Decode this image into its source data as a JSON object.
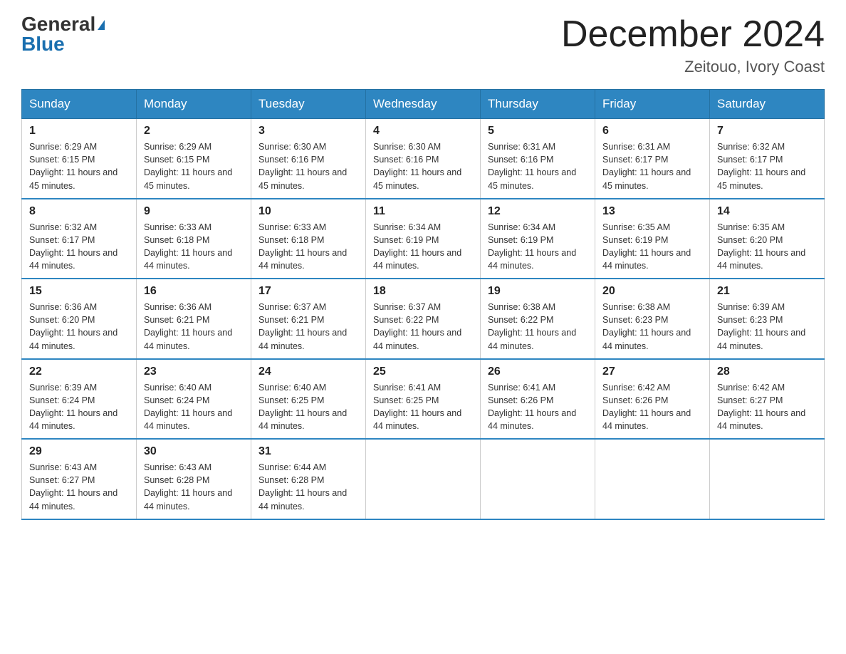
{
  "header": {
    "logo_general": "General",
    "logo_blue": "Blue",
    "title": "December 2024",
    "subtitle": "Zeitouo, Ivory Coast"
  },
  "days_of_week": [
    "Sunday",
    "Monday",
    "Tuesday",
    "Wednesday",
    "Thursday",
    "Friday",
    "Saturday"
  ],
  "weeks": [
    [
      {
        "day": "1",
        "sunrise": "6:29 AM",
        "sunset": "6:15 PM",
        "daylight": "11 hours and 45 minutes."
      },
      {
        "day": "2",
        "sunrise": "6:29 AM",
        "sunset": "6:15 PM",
        "daylight": "11 hours and 45 minutes."
      },
      {
        "day": "3",
        "sunrise": "6:30 AM",
        "sunset": "6:16 PM",
        "daylight": "11 hours and 45 minutes."
      },
      {
        "day": "4",
        "sunrise": "6:30 AM",
        "sunset": "6:16 PM",
        "daylight": "11 hours and 45 minutes."
      },
      {
        "day": "5",
        "sunrise": "6:31 AM",
        "sunset": "6:16 PM",
        "daylight": "11 hours and 45 minutes."
      },
      {
        "day": "6",
        "sunrise": "6:31 AM",
        "sunset": "6:17 PM",
        "daylight": "11 hours and 45 minutes."
      },
      {
        "day": "7",
        "sunrise": "6:32 AM",
        "sunset": "6:17 PM",
        "daylight": "11 hours and 45 minutes."
      }
    ],
    [
      {
        "day": "8",
        "sunrise": "6:32 AM",
        "sunset": "6:17 PM",
        "daylight": "11 hours and 44 minutes."
      },
      {
        "day": "9",
        "sunrise": "6:33 AM",
        "sunset": "6:18 PM",
        "daylight": "11 hours and 44 minutes."
      },
      {
        "day": "10",
        "sunrise": "6:33 AM",
        "sunset": "6:18 PM",
        "daylight": "11 hours and 44 minutes."
      },
      {
        "day": "11",
        "sunrise": "6:34 AM",
        "sunset": "6:19 PM",
        "daylight": "11 hours and 44 minutes."
      },
      {
        "day": "12",
        "sunrise": "6:34 AM",
        "sunset": "6:19 PM",
        "daylight": "11 hours and 44 minutes."
      },
      {
        "day": "13",
        "sunrise": "6:35 AM",
        "sunset": "6:19 PM",
        "daylight": "11 hours and 44 minutes."
      },
      {
        "day": "14",
        "sunrise": "6:35 AM",
        "sunset": "6:20 PM",
        "daylight": "11 hours and 44 minutes."
      }
    ],
    [
      {
        "day": "15",
        "sunrise": "6:36 AM",
        "sunset": "6:20 PM",
        "daylight": "11 hours and 44 minutes."
      },
      {
        "day": "16",
        "sunrise": "6:36 AM",
        "sunset": "6:21 PM",
        "daylight": "11 hours and 44 minutes."
      },
      {
        "day": "17",
        "sunrise": "6:37 AM",
        "sunset": "6:21 PM",
        "daylight": "11 hours and 44 minutes."
      },
      {
        "day": "18",
        "sunrise": "6:37 AM",
        "sunset": "6:22 PM",
        "daylight": "11 hours and 44 minutes."
      },
      {
        "day": "19",
        "sunrise": "6:38 AM",
        "sunset": "6:22 PM",
        "daylight": "11 hours and 44 minutes."
      },
      {
        "day": "20",
        "sunrise": "6:38 AM",
        "sunset": "6:23 PM",
        "daylight": "11 hours and 44 minutes."
      },
      {
        "day": "21",
        "sunrise": "6:39 AM",
        "sunset": "6:23 PM",
        "daylight": "11 hours and 44 minutes."
      }
    ],
    [
      {
        "day": "22",
        "sunrise": "6:39 AM",
        "sunset": "6:24 PM",
        "daylight": "11 hours and 44 minutes."
      },
      {
        "day": "23",
        "sunrise": "6:40 AM",
        "sunset": "6:24 PM",
        "daylight": "11 hours and 44 minutes."
      },
      {
        "day": "24",
        "sunrise": "6:40 AM",
        "sunset": "6:25 PM",
        "daylight": "11 hours and 44 minutes."
      },
      {
        "day": "25",
        "sunrise": "6:41 AM",
        "sunset": "6:25 PM",
        "daylight": "11 hours and 44 minutes."
      },
      {
        "day": "26",
        "sunrise": "6:41 AM",
        "sunset": "6:26 PM",
        "daylight": "11 hours and 44 minutes."
      },
      {
        "day": "27",
        "sunrise": "6:42 AM",
        "sunset": "6:26 PM",
        "daylight": "11 hours and 44 minutes."
      },
      {
        "day": "28",
        "sunrise": "6:42 AM",
        "sunset": "6:27 PM",
        "daylight": "11 hours and 44 minutes."
      }
    ],
    [
      {
        "day": "29",
        "sunrise": "6:43 AM",
        "sunset": "6:27 PM",
        "daylight": "11 hours and 44 minutes."
      },
      {
        "day": "30",
        "sunrise": "6:43 AM",
        "sunset": "6:28 PM",
        "daylight": "11 hours and 44 minutes."
      },
      {
        "day": "31",
        "sunrise": "6:44 AM",
        "sunset": "6:28 PM",
        "daylight": "11 hours and 44 minutes."
      },
      {
        "day": "",
        "sunrise": "",
        "sunset": "",
        "daylight": ""
      },
      {
        "day": "",
        "sunrise": "",
        "sunset": "",
        "daylight": ""
      },
      {
        "day": "",
        "sunrise": "",
        "sunset": "",
        "daylight": ""
      },
      {
        "day": "",
        "sunrise": "",
        "sunset": "",
        "daylight": ""
      }
    ]
  ]
}
